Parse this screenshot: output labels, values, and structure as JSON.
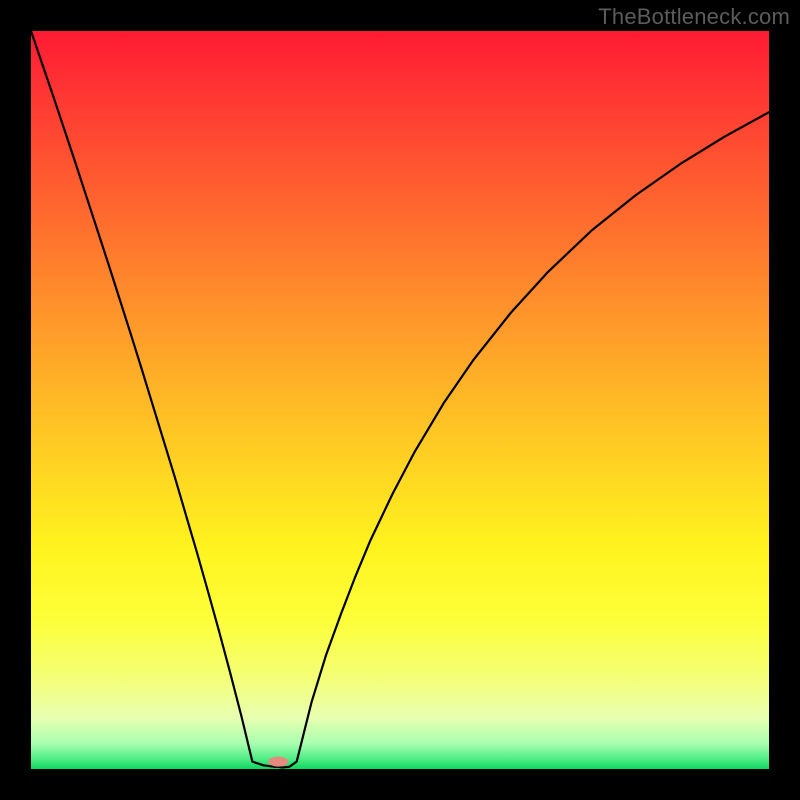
{
  "watermark": "TheBottleneck.com",
  "chart_data": {
    "type": "line",
    "title": "",
    "xlabel": "",
    "ylabel": "",
    "xlim": [
      0,
      1
    ],
    "ylim": [
      0,
      1
    ],
    "series": [
      {
        "name": "curve",
        "x": [
          0.0,
          0.015,
          0.03,
          0.045,
          0.06,
          0.075,
          0.09,
          0.105,
          0.12,
          0.135,
          0.15,
          0.165,
          0.18,
          0.195,
          0.21,
          0.225,
          0.24,
          0.255,
          0.27,
          0.285,
          0.3,
          0.315,
          0.33,
          0.335,
          0.34,
          0.35,
          0.36,
          0.37,
          0.38,
          0.4,
          0.42,
          0.44,
          0.46,
          0.49,
          0.52,
          0.56,
          0.6,
          0.65,
          0.7,
          0.76,
          0.82,
          0.88,
          0.94,
          1.0
        ],
        "values": [
          1.0,
          0.956,
          0.912,
          0.867,
          0.822,
          0.776,
          0.73,
          0.684,
          0.637,
          0.59,
          0.542,
          0.493,
          0.444,
          0.395,
          0.344,
          0.293,
          0.24,
          0.186,
          0.13,
          0.072,
          0.01,
          0.005,
          0.003,
          0.003,
          0.002,
          0.003,
          0.01,
          0.05,
          0.09,
          0.155,
          0.21,
          0.262,
          0.31,
          0.373,
          0.43,
          0.497,
          0.555,
          0.618,
          0.673,
          0.73,
          0.778,
          0.82,
          0.857,
          0.89
        ]
      }
    ],
    "marker": {
      "x": 0.335,
      "y": 0.01
    },
    "gradient_stops": [
      {
        "offset": 0.0,
        "color": "#ff1a33"
      },
      {
        "offset": 0.1,
        "color": "#ff3b33"
      },
      {
        "offset": 0.25,
        "color": "#ff6a2e"
      },
      {
        "offset": 0.4,
        "color": "#ff9a2a"
      },
      {
        "offset": 0.55,
        "color": "#ffc824"
      },
      {
        "offset": 0.7,
        "color": "#fff31e"
      },
      {
        "offset": 0.8,
        "color": "#fdff3a"
      },
      {
        "offset": 0.88,
        "color": "#f3ff7a"
      },
      {
        "offset": 0.93,
        "color": "#e9ffb0"
      },
      {
        "offset": 0.965,
        "color": "#aaffb0"
      },
      {
        "offset": 0.985,
        "color": "#55ee88"
      },
      {
        "offset": 1.0,
        "color": "#0fd760"
      }
    ]
  }
}
